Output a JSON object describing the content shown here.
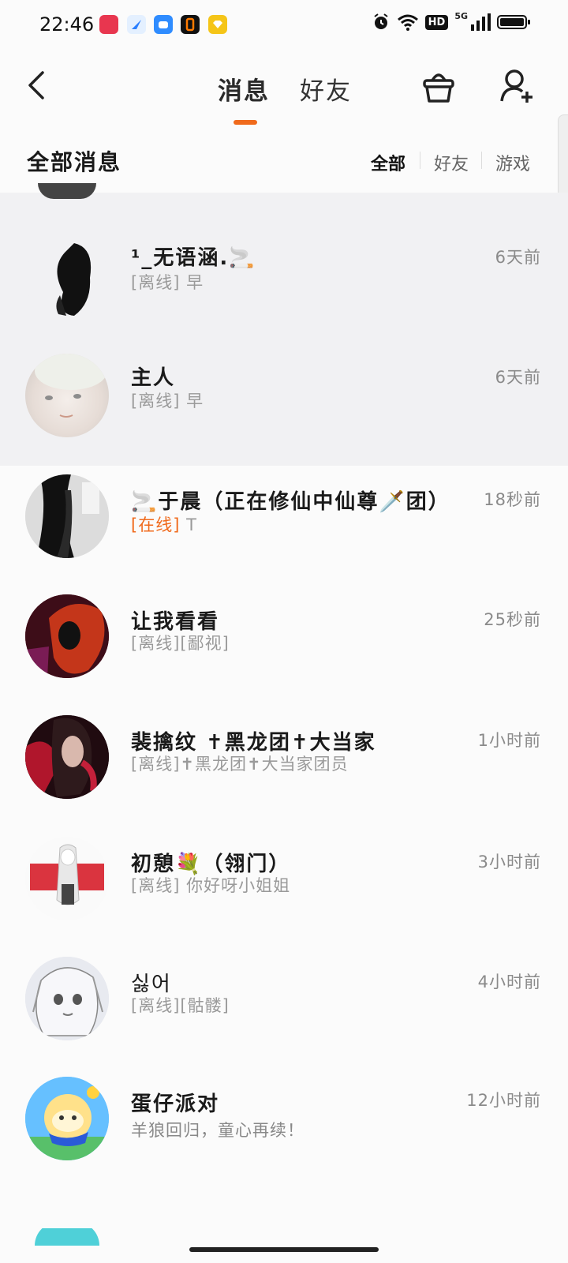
{
  "status_bar": {
    "time": "22:46",
    "app_icons": [
      "video-app-icon",
      "feather-app-icon",
      "cloud-app-icon",
      "tiktok-app-icon",
      "diamond-app-icon"
    ],
    "hd": "HD",
    "signal": "5G"
  },
  "header": {
    "tabs": [
      "消息",
      "好友"
    ],
    "active_tab": "消息",
    "accent": "#f06a1c"
  },
  "filter": {
    "title": "全部消息",
    "options": [
      "全部",
      "好友",
      "游戏"
    ],
    "active": "全部"
  },
  "messages": [
    {
      "name": "¹_无语涵.🚬",
      "status": "[离线]",
      "text": "早",
      "time": "6天前"
    },
    {
      "name": "主人",
      "status": "[离线]",
      "text": "早",
      "time": "6天前"
    },
    {
      "name": "🚬于晨（正在修仙中仙尊🗡️团）",
      "status": "[在线]",
      "text": "T",
      "time": "18秒前"
    },
    {
      "name": "让我看看",
      "status": "[离线]",
      "text": "[鄙视]",
      "time": "25秒前"
    },
    {
      "name": "裴擒纹 ✝黑龙团✝大当家",
      "status": "[离线]",
      "text": "✝黑龙团✝大当家团员",
      "time": "1小时前"
    },
    {
      "name": "初憩💐（翎门）",
      "status": "[离线]",
      "text": "你好呀小姐姐",
      "time": "3小时前"
    },
    {
      "name": "싫어",
      "status": "[离线]",
      "text": "[骷髅]",
      "time": "4小时前"
    },
    {
      "name": "蛋仔派对",
      "status": "",
      "text": "羊狼回归，童心再续！",
      "time": "12小时前"
    }
  ]
}
